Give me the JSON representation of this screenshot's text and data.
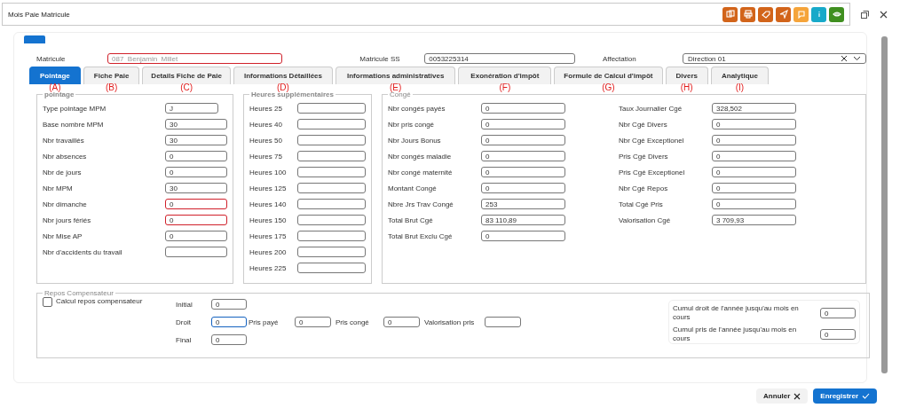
{
  "window": {
    "title": "Mois Paie Matricule",
    "toolbar": [
      {
        "kind": "documents",
        "color": "#d2641a"
      },
      {
        "kind": "print",
        "color": "#d2641a"
      },
      {
        "kind": "tag",
        "color": "#d2641a"
      },
      {
        "kind": "send",
        "color": "#d2641a"
      },
      {
        "kind": "chat",
        "color": "#f5a43a"
      },
      {
        "kind": "info",
        "color": "#17a9c9"
      },
      {
        "kind": "eye",
        "color": "#3f8f1f"
      }
    ]
  },
  "header_fields": [
    {
      "kind": "text",
      "label": "Matricule",
      "value": "087  Benjamin  Millet",
      "disabled": true,
      "invalid": true
    },
    {
      "kind": "text",
      "label": "Matricule SS",
      "value": "0053225314",
      "disabled": false,
      "invalid": false
    },
    {
      "kind": "select",
      "label": "Affectation",
      "value": "Direction 01",
      "disabled": false,
      "invalid": false
    }
  ],
  "tabs": [
    {
      "label": "Pointage",
      "selected": true,
      "annotation": "(A)"
    },
    {
      "label": "Fiche Paie",
      "selected": false,
      "annotation": "(B)"
    },
    {
      "label": "Details Fiche de Paie",
      "selected": false,
      "annotation": "(C)"
    },
    {
      "label": "Informations Détaillées",
      "selected": false,
      "annotation": "(D)"
    },
    {
      "label": "Informations administratives",
      "selected": false,
      "annotation": "(E)"
    },
    {
      "label": "Exonération d'impôt",
      "selected": false,
      "annotation": "(F)"
    },
    {
      "label": "Formule de Calcul d'impôt",
      "selected": false,
      "annotation": "(G)"
    },
    {
      "label": "Divers",
      "selected": false,
      "annotation": "(H)"
    },
    {
      "label": "Analytique",
      "selected": false,
      "annotation": "(I)"
    }
  ],
  "pointage": {
    "title": "pointage",
    "rows": [
      {
        "label": "Type pointage MPM",
        "value": "J",
        "invalid": false
      },
      {
        "label": "Base nombre MPM",
        "value": "30",
        "invalid": false
      },
      {
        "label": "Nbr travaillés",
        "value": "30",
        "invalid": false
      },
      {
        "label": "Nbr absences",
        "value": "0",
        "invalid": false
      },
      {
        "label": "Nbr de jours",
        "value": "0",
        "invalid": false
      },
      {
        "label": "Nbr MPM",
        "value": "30",
        "invalid": false
      },
      {
        "label": "Nbr dimanche",
        "value": "0",
        "invalid": true
      },
      {
        "label": "Nbr jours fériés",
        "value": "0",
        "invalid": true
      },
      {
        "label": "Nbr Mise AP",
        "value": "0",
        "invalid": false
      },
      {
        "label": "Nbr d'accidents du travail",
        "invalid": false
      }
    ]
  },
  "heures": {
    "title": "Heures supplémentaires",
    "rows": [
      {
        "label": "Heures 25"
      },
      {
        "label": "Heures 40"
      },
      {
        "label": "Heures 50"
      },
      {
        "label": "Heures 75"
      },
      {
        "label": "Heures 100"
      },
      {
        "label": "Heures 125"
      },
      {
        "label": "Heures 140"
      },
      {
        "label": "Heures 150"
      },
      {
        "label": "Heures 175"
      },
      {
        "label": "Heures 200"
      },
      {
        "label": "Heures 225"
      }
    ]
  },
  "conge": {
    "title": "Congé",
    "left": [
      {
        "label": "Nbr congés payés",
        "value": "0"
      },
      {
        "label": "Nbr pris congé",
        "value": "0"
      },
      {
        "label": "Nbr Jours Bonus",
        "value": "0"
      },
      {
        "label": "Nbr congés maladie",
        "value": "0"
      },
      {
        "label": "Nbr congé maternité",
        "value": "0"
      },
      {
        "label": "Montant Congé",
        "value": "0"
      },
      {
        "label": "Nbre Jrs Trav Congé",
        "value": "253"
      },
      {
        "label": "Total Brut Cgé",
        "value": "83 110,89"
      },
      {
        "label": "Total Brut Exclu Cgé",
        "value": "0"
      }
    ],
    "right": [
      {
        "label": "Taux Journalier Cgé",
        "value": "328,502"
      },
      {
        "label": "Nbr Cgé Divers",
        "value": "0"
      },
      {
        "label": "Nbr Cgé Exceptionel",
        "value": "0"
      },
      {
        "label": "Pris Cgé Divers",
        "value": "0"
      },
      {
        "label": "Pris Cgé Exceptionel",
        "value": "0"
      },
      {
        "label": "Nbr Cgé Repos",
        "value": "0"
      },
      {
        "label": "Total Cgé Pris",
        "value": "0"
      },
      {
        "label": "Valorisation Cgé",
        "value": "3 709,93"
      }
    ]
  },
  "repos": {
    "title": "Repos Compensateur",
    "checkbox": {
      "label": "Calcul repos compensateur",
      "checked": false
    },
    "initial": {
      "label": "Initial",
      "value": "0",
      "focused": false
    },
    "droit": {
      "label": "Droit",
      "value": "0",
      "focused": true
    },
    "droit_extra": [
      {
        "label": "Pris payé",
        "value": "0"
      },
      {
        "label": "Pris congé",
        "value": "0"
      },
      {
        "label": "Valorisation pris"
      }
    ],
    "final": {
      "label": "Final",
      "value": "0",
      "focused": false
    },
    "cumuls": [
      {
        "label": "Cumul droit de l'année jusqu'au mois en cours",
        "value": "0"
      },
      {
        "label": "Cumul pris de l'année jusqu'au mois en cours",
        "value": "0"
      }
    ]
  },
  "footer": {
    "buttons": [
      {
        "kind": "cancel",
        "label": "Annuler"
      },
      {
        "kind": "save",
        "label": "Enregistrer"
      }
    ]
  }
}
